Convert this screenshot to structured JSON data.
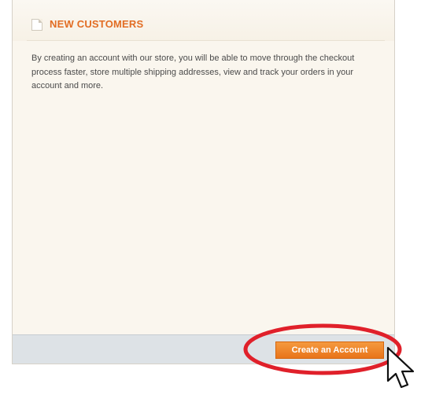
{
  "panel": {
    "title": "NEW CUSTOMERS",
    "description": "By creating an account with our store, you will be able to move through the checkout process faster, store multiple shipping addresses, view and track your orders in your account and more.",
    "button_label": "Create an Account"
  },
  "icons": {
    "header_icon": "document-icon",
    "pointer": "cursor-arrow-icon"
  },
  "colors": {
    "title": "#e26d24",
    "button": "#f08a2e",
    "highlight": "#e0202a",
    "panel_bg": "#faf6ee",
    "footer_bg": "#dde2e6"
  }
}
